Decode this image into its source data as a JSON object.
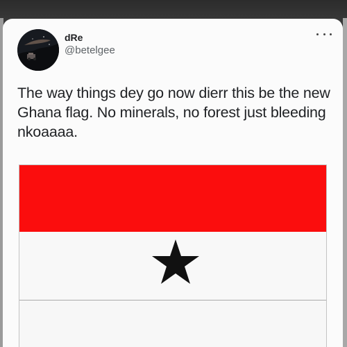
{
  "tweet": {
    "author": {
      "display_name": "dRe",
      "handle": "@betelgee",
      "avatar_icon": "night-sky-avatar"
    },
    "text": "The way things dey go now dierr this be the new Ghana flag. No minerals, no forest just bleeding nkoaaaa.",
    "more_icon": "more-dots-icon",
    "image": {
      "description_icons": [
        "black-star-icon"
      ],
      "colors": {
        "red_band": "#fb0d0d",
        "white_band": "#f8f8f8",
        "star": "#111111"
      }
    }
  }
}
